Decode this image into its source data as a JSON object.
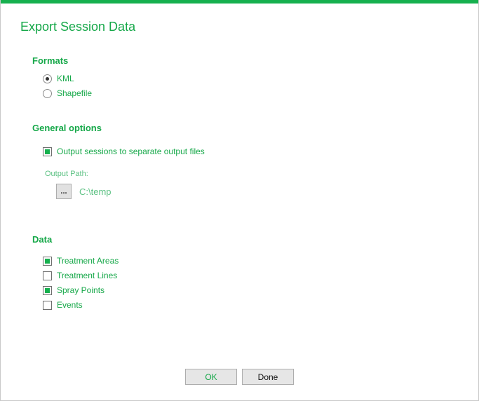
{
  "dialog": {
    "title": "Export Session Data"
  },
  "formats": {
    "title": "Formats",
    "options": [
      {
        "label": "KML",
        "selected": true
      },
      {
        "label": "Shapefile",
        "selected": false
      }
    ]
  },
  "general": {
    "title": "General options",
    "separate_files": {
      "label": "Output sessions to separate output files",
      "checked": true
    },
    "output_path_label": "Output Path:",
    "browse_label": "...",
    "output_path_value": "C:\\temp"
  },
  "data": {
    "title": "Data",
    "items": [
      {
        "label": "Treatment Areas",
        "checked": true
      },
      {
        "label": "Treatment Lines",
        "checked": false
      },
      {
        "label": "Spray Points",
        "checked": true
      },
      {
        "label": "Events",
        "checked": false
      }
    ]
  },
  "buttons": {
    "ok_label": "OK",
    "done_label": "Done"
  },
  "colors": {
    "accent": "#16b04e",
    "text_green": "#16a849",
    "muted_green": "#5cc183"
  }
}
